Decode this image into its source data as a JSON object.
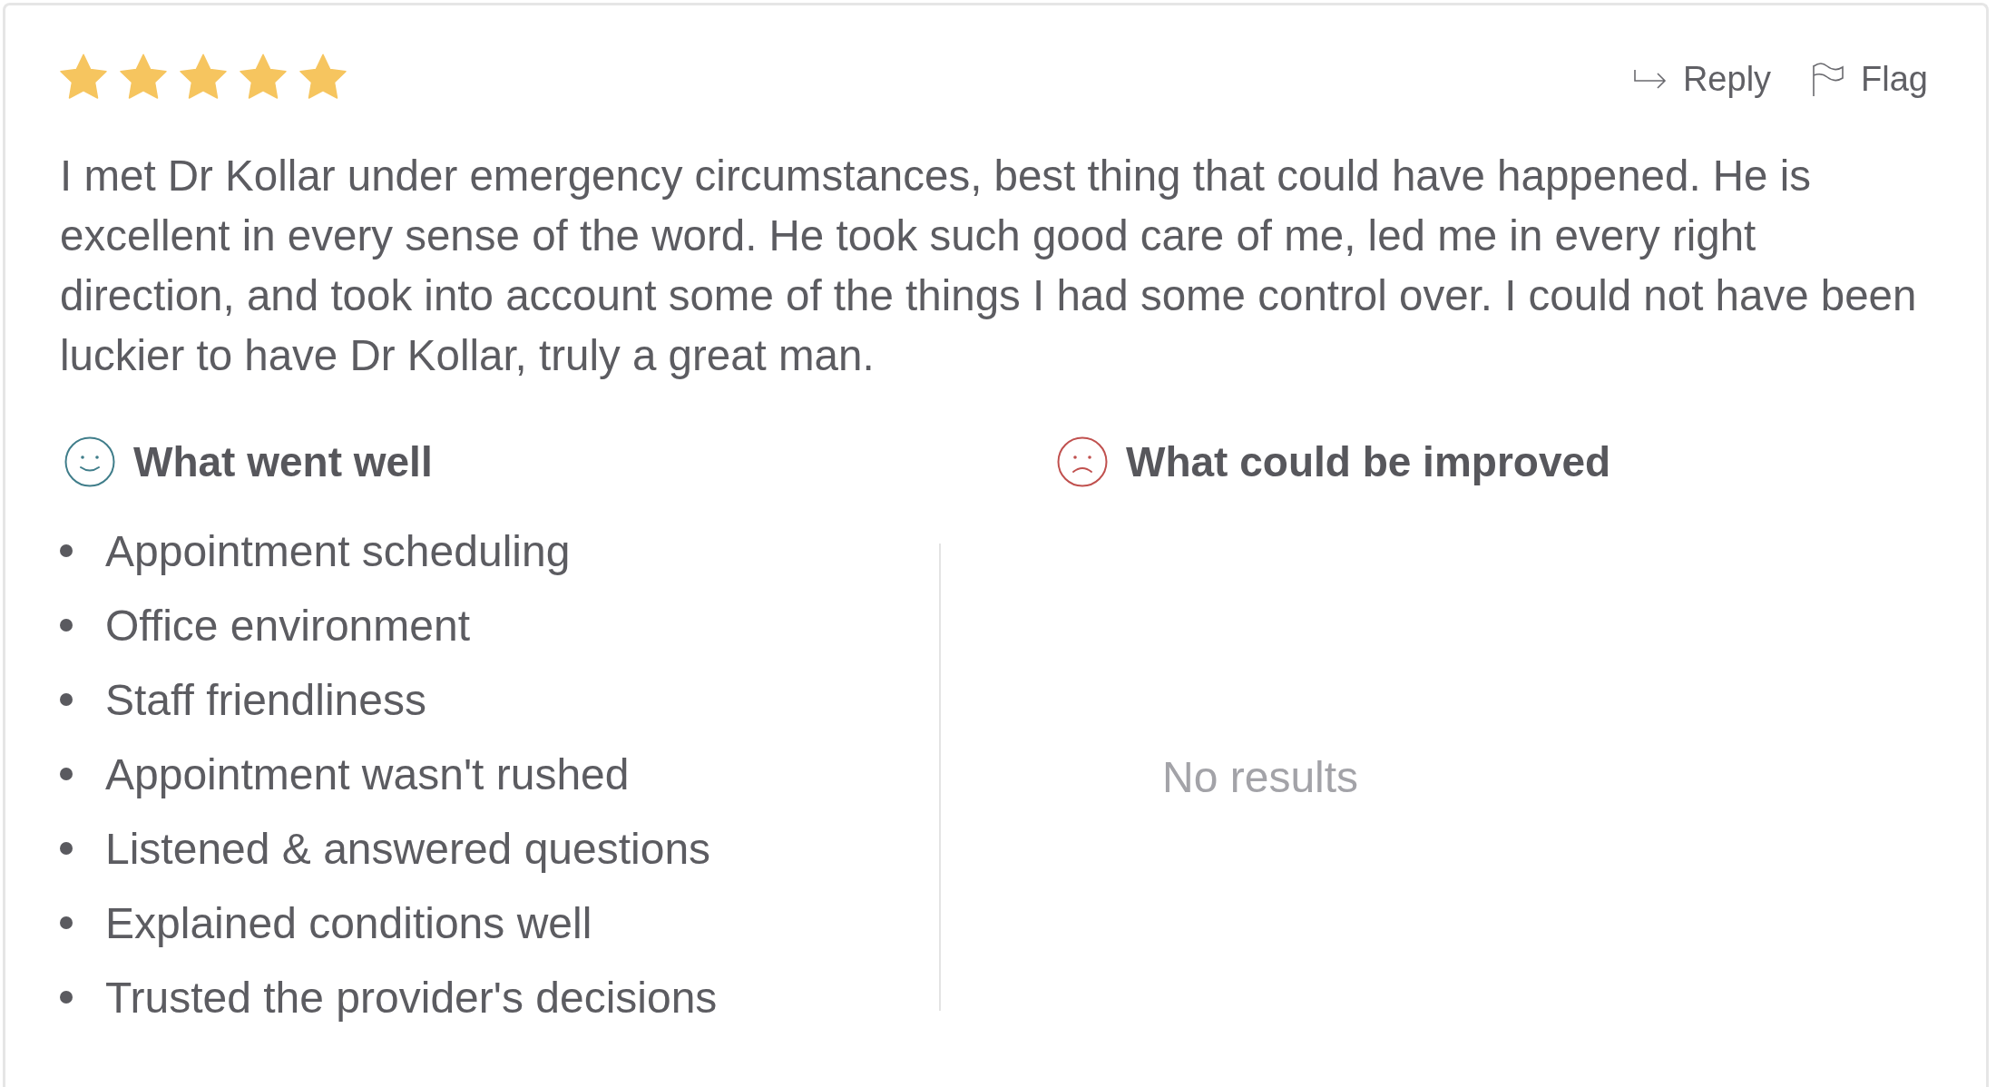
{
  "review": {
    "stars": 5,
    "actions": [
      {
        "kind": "reply",
        "label": "Reply"
      },
      {
        "kind": "flag",
        "label": "Flag"
      }
    ],
    "text": "I met Dr Kollar under emergency circumstances, best thing that could have happened. He is excellent in every sense of the word. He took such good care of me, led me in every right direction, and took into account some of the things I had some control over. I could not have been luckier to have Dr Kollar, truly a great man.",
    "sections": [
      {
        "kind": "positive",
        "title": "What went well",
        "items": [
          "Appointment scheduling",
          "Office environment",
          "Staff friendliness",
          "Appointment wasn't rushed",
          "Listened & answered questions",
          "Explained conditions well",
          "Trusted the provider's decisions"
        ]
      },
      {
        "kind": "negative",
        "title": "What could be improved",
        "empty_text": "No results"
      }
    ]
  }
}
